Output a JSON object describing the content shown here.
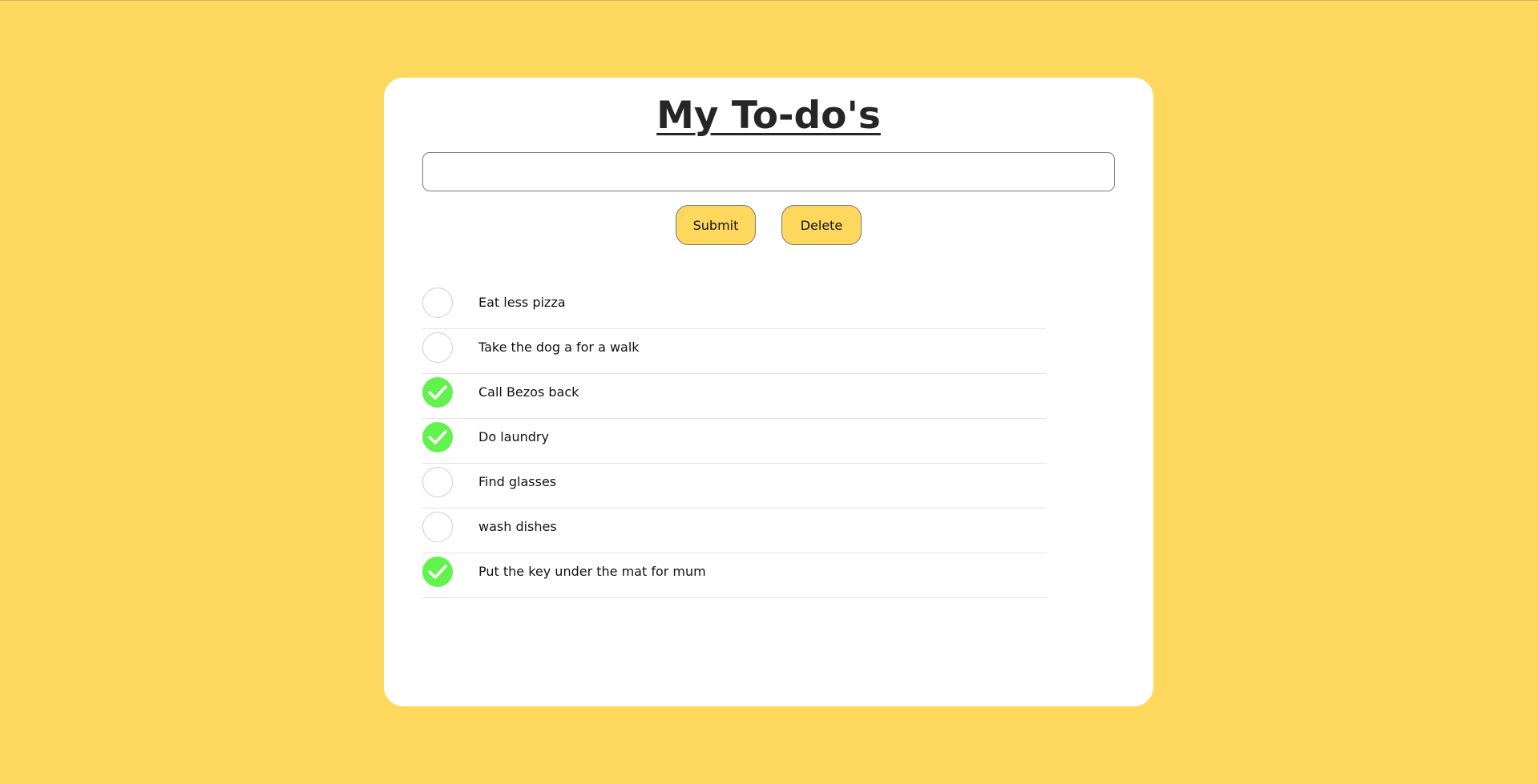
{
  "page": {
    "background": "#fdd85d",
    "card_background": "#ffffff",
    "accent_check": "#62f24e"
  },
  "header": {
    "title": "My To-do's"
  },
  "input": {
    "value": "",
    "placeholder": ""
  },
  "buttons": {
    "submit_label": "Submit",
    "delete_label": "Delete"
  },
  "todos": [
    {
      "text": "Eat less pizza",
      "done": false
    },
    {
      "text": "Take the dog a for a walk",
      "done": false
    },
    {
      "text": "Call Bezos back",
      "done": true
    },
    {
      "text": "Do laundry",
      "done": true
    },
    {
      "text": "Find glasses",
      "done": false
    },
    {
      "text": "wash dishes",
      "done": false
    },
    {
      "text": "Put the key under the mat for mum",
      "done": true
    }
  ]
}
